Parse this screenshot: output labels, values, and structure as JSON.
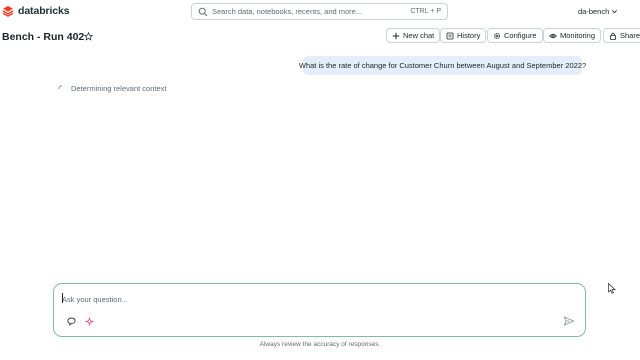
{
  "app": {
    "brand": "databricks",
    "brand_color": "#ff3621"
  },
  "search": {
    "placeholder": "Search data, notebooks, recents, and more...",
    "shortcut": "CTRL + P"
  },
  "workspace": {
    "name": "da-bench"
  },
  "page": {
    "title": "Bench - Run 402"
  },
  "toolbar": {
    "new_chat": "New chat",
    "history": "History",
    "configure": "Configure",
    "monitoring": "Monitoring",
    "share": "Share"
  },
  "conversation": {
    "user_message": "What is the rate of change for Customer Churn between August and September 2022?",
    "status_text": "Determining relevant context"
  },
  "composer": {
    "placeholder": "Ask your question...",
    "accent": "#7fbf9f"
  },
  "footer": {
    "disclaimer": "Always review the accuracy of responses."
  },
  "icons": [
    "databricks-logo-icon",
    "search-icon",
    "chevron-down-icon",
    "star-icon",
    "plus-icon",
    "history-icon",
    "gear-icon",
    "eye-icon",
    "lock-icon",
    "spinner-icon",
    "comment-icon",
    "sparkle-icon",
    "send-icon",
    "mouse-cursor-icon"
  ]
}
